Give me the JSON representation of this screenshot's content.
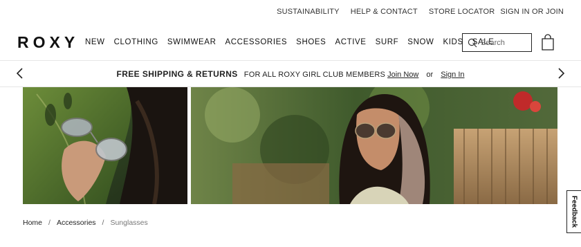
{
  "topbar": {
    "links": [
      "SUSTAINABILITY",
      "HELP & CONTACT",
      "STORE LOCATOR"
    ],
    "signin": "SIGN IN OR JOIN"
  },
  "header": {
    "logo": "ROXY",
    "nav": [
      "NEW",
      "CLOTHING",
      "SWIMWEAR",
      "ACCESSORIES",
      "SHOES",
      "ACTIVE",
      "SURF",
      "SNOW",
      "KIDS",
      "SALE"
    ],
    "search_placeholder": "Search",
    "search_icon": "search-icon",
    "bag_icon": "shopping-bag-icon"
  },
  "promo": {
    "headline": "FREE SHIPPING & RETURNS",
    "subtext": "FOR ALL ROXY GIRL CLUB MEMBERS",
    "join_label": "Join Now",
    "or_label": "or",
    "signin_label": "Sign In"
  },
  "breadcrumb": {
    "items": [
      "Home",
      "Accessories"
    ],
    "current": "Sunglasses"
  },
  "feedback": {
    "label": "Feedback"
  },
  "colors": {
    "text": "#222222",
    "border": "#e6e6e6",
    "foliage": "#58703f"
  }
}
